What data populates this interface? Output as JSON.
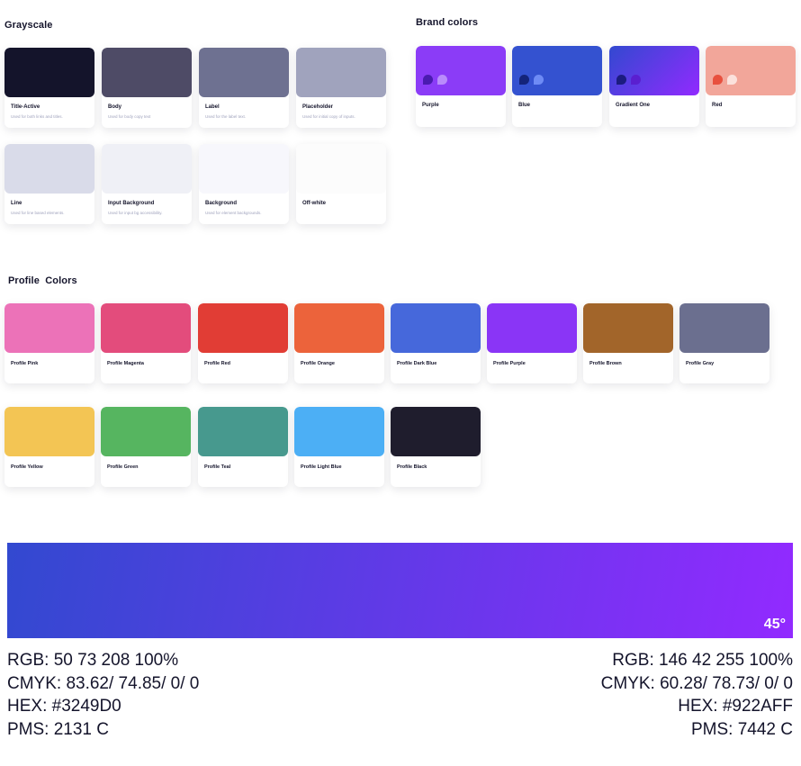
{
  "grayscale": {
    "title": "Grayscale",
    "items": [
      {
        "name": "Title-Active",
        "desc": "Used for both links and titles.",
        "color": "#14142B"
      },
      {
        "name": "Body",
        "desc": "Used for body copy text",
        "color": "#4E4B66"
      },
      {
        "name": "Label",
        "desc": "Used for the label text.",
        "color": "#6E7191"
      },
      {
        "name": "Placeholder",
        "desc": "Used for initial copy of inputs.",
        "color": "#A0A3BD"
      },
      {
        "name": "Line",
        "desc": "Used for line based elements.",
        "color": "#D9DBE9"
      },
      {
        "name": "Input Background",
        "desc": "Used for input bg accessibility.",
        "color": "#EFF0F6"
      },
      {
        "name": "Background",
        "desc": "Used for element backgrounds.",
        "color": "#F7F7FC"
      },
      {
        "name": "Off-white",
        "desc": "",
        "color": "#FCFCFC"
      }
    ]
  },
  "brand": {
    "title": "Brand colors",
    "items": [
      {
        "name": "Purple",
        "color": "#8B3CF7",
        "dot1": "#4A1BB0",
        "dot2": "#B98CFB"
      },
      {
        "name": "Blue",
        "color": "#3452D0",
        "dot1": "#14247A",
        "dot2": "#6E8BF5"
      },
      {
        "name": "Gradient One",
        "color": "#5B3EE0",
        "dot1": "#1C1C80",
        "dot2": "#5A1FD0"
      },
      {
        "name": "Red",
        "color": "#F2A69A",
        "dot1": "#E8503E",
        "dot2": "#FBE1DC"
      }
    ]
  },
  "profile": {
    "title": "Profile  Colors",
    "items": [
      {
        "name": "Profile Pink",
        "color": "#EC72B8"
      },
      {
        "name": "Profile Magenta",
        "color": "#E34C7C"
      },
      {
        "name": "Profile Red",
        "color": "#E13D35"
      },
      {
        "name": "Profile Orange",
        "color": "#EC633B"
      },
      {
        "name": "Profile Dark Blue",
        "color": "#4668DB"
      },
      {
        "name": "Profile Purple",
        "color": "#8A35F6"
      },
      {
        "name": "Profile Brown",
        "color": "#A2652A"
      },
      {
        "name": "Profile Gray",
        "color": "#6B6F8F"
      },
      {
        "name": "Profile Yellow",
        "color": "#F3C554"
      },
      {
        "name": "Profile Green",
        "color": "#56B560"
      },
      {
        "name": "Profile Teal",
        "color": "#47998E"
      },
      {
        "name": "Profile Light Blue",
        "color": "#4CAFF5"
      },
      {
        "name": "Profile Black",
        "color": "#1F1D2D"
      }
    ]
  },
  "gradient": {
    "angle": "45°",
    "start_color": "#3249D0",
    "end_color": "#922AFF",
    "left": {
      "rgb": "RGB: 50 73 208 100%",
      "cmyk": "CMYK: 83.62/ 74.85/ 0/ 0",
      "hex": "HEX: #3249D0",
      "pms": "PMS: 2131 C"
    },
    "right": {
      "rgb": "RGB: 146 42 255 100%",
      "cmyk": "CMYK: 60.28/ 78.73/ 0/ 0",
      "hex": "HEX: #922AFF",
      "pms": "PMS: 7442 C"
    }
  }
}
